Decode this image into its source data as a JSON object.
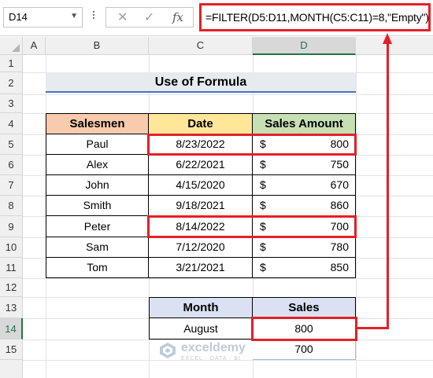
{
  "formula_bar": {
    "name_box": "D14",
    "cancel_icon": "✕",
    "enter_icon": "✓",
    "fx_label": "fx",
    "formula": "=FILTER(D5:D11,MONTH(C5:C11)=8,\"Empty\")"
  },
  "columns": [
    "A",
    "B",
    "C",
    "D"
  ],
  "rows": [
    "1",
    "2",
    "3",
    "4",
    "5",
    "6",
    "7",
    "8",
    "9",
    "10",
    "11",
    "12",
    "13",
    "14",
    "15"
  ],
  "selected_cell": "D14",
  "sheet": {
    "title": "Use of Formula",
    "headers": {
      "salesmen": "Salesmen",
      "date": "Date",
      "amount": "Sales Amount"
    },
    "currency_symbol": "$",
    "rows": [
      {
        "name": "Paul",
        "date": "8/23/2022",
        "amount": "800"
      },
      {
        "name": "Alex",
        "date": "6/22/2021",
        "amount": "750"
      },
      {
        "name": "John",
        "date": "4/15/2020",
        "amount": "670"
      },
      {
        "name": "Smith",
        "date": "9/18/2021",
        "amount": "860"
      },
      {
        "name": "Peter",
        "date": "8/14/2022",
        "amount": "700"
      },
      {
        "name": "Sam",
        "date": "7/12/2020",
        "amount": "780"
      },
      {
        "name": "Tom",
        "date": "3/21/2021",
        "amount": "850"
      }
    ],
    "result_table": {
      "headers": {
        "month": "Month",
        "sales": "Sales"
      },
      "month": "August",
      "sales": [
        "800",
        "700"
      ]
    }
  },
  "watermark": {
    "name": "exceldemy",
    "tagline": "EXCEL · DATA · BI"
  },
  "colors": {
    "highlight_red": "#e51f26",
    "header_salesmen": "#f8cbad",
    "header_date": "#ffe699",
    "header_amount": "#c6e0b4",
    "header_result": "#d9e1f2",
    "excel_green": "#217346"
  }
}
